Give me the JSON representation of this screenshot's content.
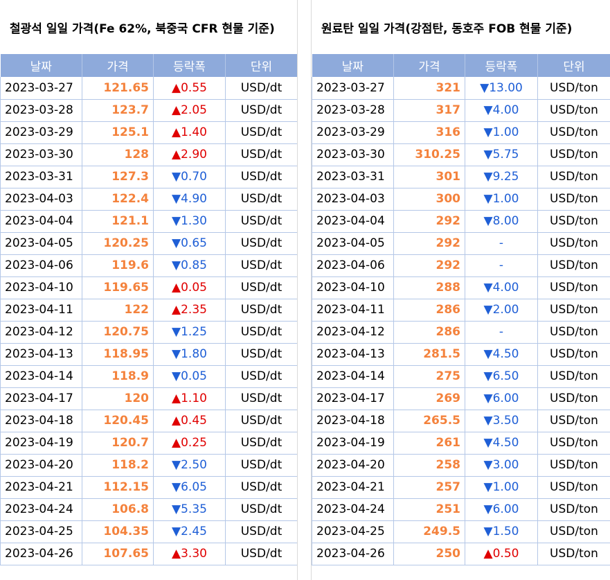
{
  "left": {
    "title": "철광석 일일 가격(Fe 62%, 북중국 CFR 현물 기준)",
    "headers": [
      "날짜",
      "가격",
      "등락폭",
      "단위"
    ],
    "rows": [
      {
        "date": "2023-03-27",
        "price": "121.65",
        "change": "▲0.55",
        "unit": "USD/dt"
      },
      {
        "date": "2023-03-28",
        "price": "123.7",
        "change": "▲2.05",
        "unit": "USD/dt"
      },
      {
        "date": "2023-03-29",
        "price": "125.1",
        "change": "▲1.40",
        "unit": "USD/dt"
      },
      {
        "date": "2023-03-30",
        "price": "128",
        "change": "▲2.90",
        "unit": "USD/dt"
      },
      {
        "date": "2023-03-31",
        "price": "127.3",
        "change": "▼0.70",
        "unit": "USD/dt"
      },
      {
        "date": "2023-04-03",
        "price": "122.4",
        "change": "▼4.90",
        "unit": "USD/dt"
      },
      {
        "date": "2023-04-04",
        "price": "121.1",
        "change": "▼1.30",
        "unit": "USD/dt"
      },
      {
        "date": "2023-04-05",
        "price": "120.25",
        "change": "▼0.65",
        "unit": "USD/dt"
      },
      {
        "date": "2023-04-06",
        "price": "119.6",
        "change": "▼0.85",
        "unit": "USD/dt"
      },
      {
        "date": "2023-04-10",
        "price": "119.65",
        "change": "▲0.05",
        "unit": "USD/dt"
      },
      {
        "date": "2023-04-11",
        "price": "122",
        "change": "▲2.35",
        "unit": "USD/dt"
      },
      {
        "date": "2023-04-12",
        "price": "120.75",
        "change": "▼1.25",
        "unit": "USD/dt"
      },
      {
        "date": "2023-04-13",
        "price": "118.95",
        "change": "▼1.80",
        "unit": "USD/dt"
      },
      {
        "date": "2023-04-14",
        "price": "118.9",
        "change": "▼0.05",
        "unit": "USD/dt"
      },
      {
        "date": "2023-04-17",
        "price": "120",
        "change": "▲1.10",
        "unit": "USD/dt"
      },
      {
        "date": "2023-04-18",
        "price": "120.45",
        "change": "▲0.45",
        "unit": "USD/dt"
      },
      {
        "date": "2023-04-19",
        "price": "120.7",
        "change": "▲0.25",
        "unit": "USD/dt"
      },
      {
        "date": "2023-04-20",
        "price": "118.2",
        "change": "▼2.50",
        "unit": "USD/dt"
      },
      {
        "date": "2023-04-21",
        "price": "112.15",
        "change": "▼6.05",
        "unit": "USD/dt"
      },
      {
        "date": "2023-04-24",
        "price": "106.8",
        "change": "▼5.35",
        "unit": "USD/dt"
      },
      {
        "date": "2023-04-25",
        "price": "104.35",
        "change": "▼2.45",
        "unit": "USD/dt"
      },
      {
        "date": "2023-04-26",
        "price": "107.65",
        "change": "▲3.30",
        "unit": "USD/dt"
      }
    ]
  },
  "right": {
    "title": "원료탄 일일 가격(강점탄, 동호주 FOB 현물 기준)",
    "headers": [
      "날짜",
      "가격",
      "등락폭",
      "단위"
    ],
    "rows": [
      {
        "date": "2023-03-27",
        "price": "321",
        "change": "▼13.00",
        "unit": "USD/ton"
      },
      {
        "date": "2023-03-28",
        "price": "317",
        "change": "▼4.00",
        "unit": "USD/ton"
      },
      {
        "date": "2023-03-29",
        "price": "316",
        "change": "▼1.00",
        "unit": "USD/ton"
      },
      {
        "date": "2023-03-30",
        "price": "310.25",
        "change": "▼5.75",
        "unit": "USD/ton"
      },
      {
        "date": "2023-03-31",
        "price": "301",
        "change": "▼9.25",
        "unit": "USD/ton"
      },
      {
        "date": "2023-04-03",
        "price": "300",
        "change": "▼1.00",
        "unit": "USD/ton"
      },
      {
        "date": "2023-04-04",
        "price": "292",
        "change": "▼8.00",
        "unit": "USD/ton"
      },
      {
        "date": "2023-04-05",
        "price": "292",
        "change": "-",
        "unit": "USD/ton"
      },
      {
        "date": "2023-04-06",
        "price": "292",
        "change": "-",
        "unit": "USD/ton"
      },
      {
        "date": "2023-04-10",
        "price": "288",
        "change": "▼4.00",
        "unit": "USD/ton"
      },
      {
        "date": "2023-04-11",
        "price": "286",
        "change": "▼2.00",
        "unit": "USD/ton"
      },
      {
        "date": "2023-04-12",
        "price": "286",
        "change": "-",
        "unit": "USD/ton"
      },
      {
        "date": "2023-04-13",
        "price": "281.5",
        "change": "▼4.50",
        "unit": "USD/ton"
      },
      {
        "date": "2023-04-14",
        "price": "275",
        "change": "▼6.50",
        "unit": "USD/ton"
      },
      {
        "date": "2023-04-17",
        "price": "269",
        "change": "▼6.00",
        "unit": "USD/ton"
      },
      {
        "date": "2023-04-18",
        "price": "265.5",
        "change": "▼3.50",
        "unit": "USD/ton"
      },
      {
        "date": "2023-04-19",
        "price": "261",
        "change": "▼4.50",
        "unit": "USD/ton"
      },
      {
        "date": "2023-04-20",
        "price": "258",
        "change": "▼3.00",
        "unit": "USD/ton"
      },
      {
        "date": "2023-04-21",
        "price": "257",
        "change": "▼1.00",
        "unit": "USD/ton"
      },
      {
        "date": "2023-04-24",
        "price": "251",
        "change": "▼6.00",
        "unit": "USD/ton"
      },
      {
        "date": "2023-04-25",
        "price": "249.5",
        "change": "▼1.50",
        "unit": "USD/ton"
      },
      {
        "date": "2023-04-26",
        "price": "250",
        "change": "▲0.50",
        "unit": "USD/ton"
      }
    ]
  },
  "colors": {
    "header_bg": "#8eaadb",
    "price": "#f4823c",
    "up": "#e00000",
    "down": "#1f5fd6",
    "grid": "#b4c7e7"
  }
}
